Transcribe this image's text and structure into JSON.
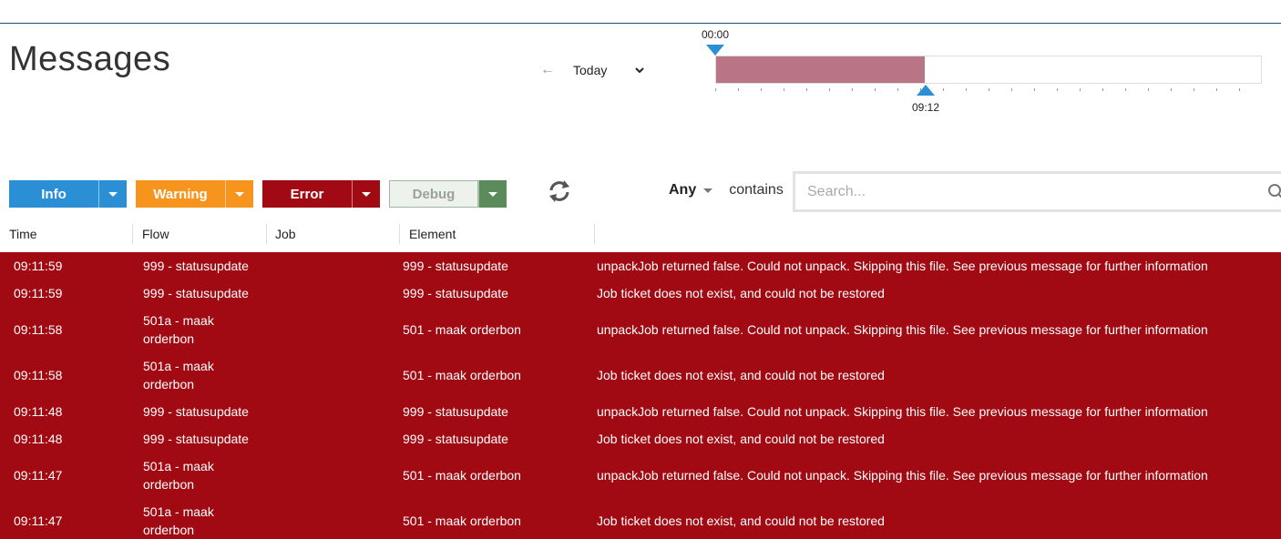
{
  "page": {
    "title": "Messages"
  },
  "day_picker": {
    "prev_icon": "arrow-left-icon",
    "label": "Today",
    "dropdown_icon": "chevron-down-icon"
  },
  "timeline": {
    "start_label": "00:00",
    "end_label": "09:12",
    "selected_fraction": 0.383,
    "fill_color": "#b97586",
    "handle_color": "#2b8fd6"
  },
  "filters": {
    "info": {
      "label": "Info",
      "color": "#2b8fd6",
      "drop_color": "#2b8fd6"
    },
    "warning": {
      "label": "Warning",
      "color": "#f7941d",
      "drop_color": "#f7941d"
    },
    "error": {
      "label": "Error",
      "color": "#a10a12",
      "drop_color": "#a10a12"
    },
    "debug": {
      "label": "Debug",
      "color": "#edf2ec",
      "drop_color": "#5b8a5b",
      "text_color": "#9aa39a"
    }
  },
  "refresh": {
    "icon": "refresh-icon"
  },
  "search": {
    "scope": "Any",
    "operator": "contains",
    "placeholder": "Search...",
    "value": "",
    "icon": "search-icon"
  },
  "table": {
    "columns": [
      "Time",
      "Flow",
      "Job",
      "Element"
    ],
    "row_color": "#a10a12",
    "rows": [
      {
        "time": "09:11:59",
        "flow": "999 - statusupdate",
        "job": "",
        "element": "999 - statusupdate",
        "message": "unpackJob returned false. Could not unpack. Skipping this file. See previous message for further information"
      },
      {
        "time": "09:11:59",
        "flow": "999 - statusupdate",
        "job": "",
        "element": "999 - statusupdate",
        "message": "Job ticket does not exist, and could not be restored"
      },
      {
        "time": "09:11:58",
        "flow": "501a - maak orderbon",
        "job": "",
        "element": "501 - maak orderbon",
        "message": "unpackJob returned false. Could not unpack. Skipping this file. See previous message for further information"
      },
      {
        "time": "09:11:58",
        "flow": "501a - maak orderbon",
        "job": "",
        "element": "501 - maak orderbon",
        "message": "Job ticket does not exist, and could not be restored"
      },
      {
        "time": "09:11:48",
        "flow": "999 - statusupdate",
        "job": "",
        "element": "999 - statusupdate",
        "message": "unpackJob returned false. Could not unpack. Skipping this file. See previous message for further information"
      },
      {
        "time": "09:11:48",
        "flow": "999 - statusupdate",
        "job": "",
        "element": "999 - statusupdate",
        "message": "Job ticket does not exist, and could not be restored"
      },
      {
        "time": "09:11:47",
        "flow": "501a - maak orderbon",
        "job": "",
        "element": "501 - maak orderbon",
        "message": "unpackJob returned false. Could not unpack. Skipping this file. See previous message for further information"
      },
      {
        "time": "09:11:47",
        "flow": "501a - maak orderbon",
        "job": "",
        "element": "501 - maak orderbon",
        "message": "Job ticket does not exist, and could not be restored"
      }
    ]
  }
}
